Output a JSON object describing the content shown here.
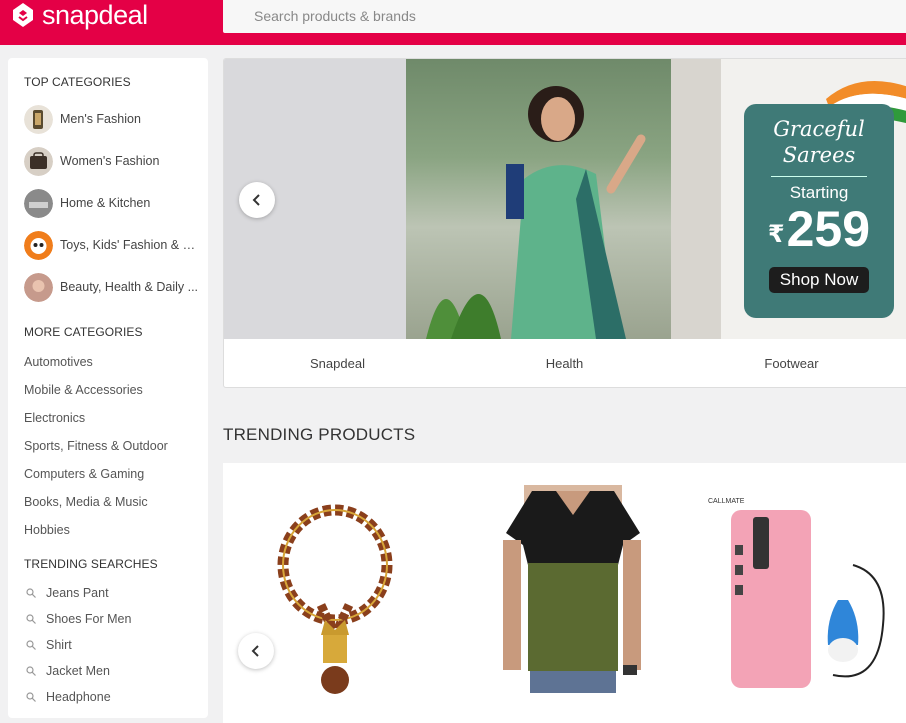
{
  "header": {
    "logo_text": "snapdeal",
    "brand_color": "#e40046",
    "search_placeholder": "Search products & brands"
  },
  "sidebar": {
    "top_title": "TOP CATEGORIES",
    "top_categories": [
      {
        "label": "Men's Fashion"
      },
      {
        "label": "Women's Fashion"
      },
      {
        "label": "Home & Kitchen"
      },
      {
        "label": "Toys, Kids' Fashion & m..."
      },
      {
        "label": "Beauty, Health & Daily ..."
      }
    ],
    "more_title": "MORE CATEGORIES",
    "more_categories": [
      {
        "label": "Automotives"
      },
      {
        "label": "Mobile & Accessories"
      },
      {
        "label": "Electronics"
      },
      {
        "label": "Sports, Fitness & Outdoor"
      },
      {
        "label": "Computers & Gaming"
      },
      {
        "label": "Books, Media & Music"
      },
      {
        "label": "Hobbies"
      }
    ],
    "trend_title": "TRENDING SEARCHES",
    "trending_searches": [
      {
        "label": "Jeans Pant"
      },
      {
        "label": "Shoes For Men"
      },
      {
        "label": "Shirt"
      },
      {
        "label": "Jacket Men"
      },
      {
        "label": "Headphone"
      }
    ]
  },
  "banner": {
    "promo_title_line1": "Graceful",
    "promo_title_line2": "Sarees",
    "promo_starting": "Starting",
    "promo_rupee": "₹",
    "promo_price": "259",
    "promo_button": "Shop Now",
    "tabs": [
      {
        "label": "Snapdeal"
      },
      {
        "label": "Health"
      },
      {
        "label": "Footwear"
      }
    ]
  },
  "trending": {
    "title": "TRENDING PRODUCTS",
    "products": [
      {
        "name": "rudraksha-mala"
      },
      {
        "name": "mens-tshirt"
      },
      {
        "name": "power-bank"
      }
    ]
  }
}
